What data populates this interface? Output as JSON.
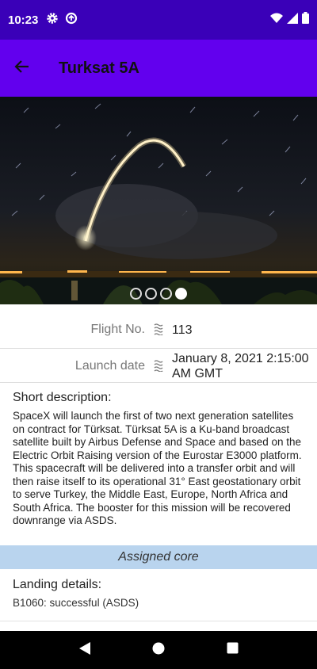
{
  "status_bar": {
    "time": "10:23",
    "icons_left": [
      "gear-icon",
      "data-saver-icon"
    ],
    "icons_right": [
      "wifi-icon",
      "signal-icon",
      "battery-icon"
    ]
  },
  "app_bar": {
    "title": "Turksat 5A",
    "back_icon": "arrow-back-icon",
    "color": "#6200ee"
  },
  "hero": {
    "pages": 4,
    "active_page": 4
  },
  "details": [
    {
      "label": "Flight No.",
      "icon": "waves-icon",
      "value": "113"
    },
    {
      "label": "Launch date",
      "icon": "waves-icon",
      "value": "January 8, 2021 2:15:00 AM GMT"
    }
  ],
  "description": {
    "title": "Short description:",
    "text": "SpaceX will launch the first of two next generation satellites on contract for Türksat. Türksat 5A is a Ku-band broadcast satellite built by Airbus Defense and Space and based on the Electric Orbit Raising version of the Eurostar E3000 platform. This spacecraft will be delivered into a transfer orbit and will then raise itself to its operational 31° East geostationary orbit to serve Turkey, the Middle East, Europe, North Africa and South Africa. The booster for this mission will be recovered downrange via ASDS."
  },
  "core": {
    "header": "Assigned core",
    "header_color": "#b9d4ee",
    "landing_title": "Landing details:",
    "landing_text": "B1060: successful (ASDS)"
  },
  "nav_bar": {
    "buttons": [
      "back-icon",
      "home-icon",
      "recents-icon"
    ]
  }
}
